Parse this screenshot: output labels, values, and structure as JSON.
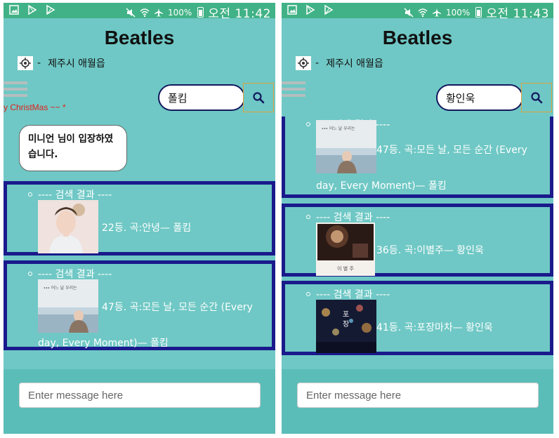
{
  "status_bar": [
    {
      "battery": "100%",
      "time": "오전 11:42"
    },
    {
      "battery": "100%",
      "time": "오전 11:43"
    }
  ],
  "header": {
    "title": "Beatles",
    "location_sep": "-",
    "location": "제주시 애월읍"
  },
  "ticker": "y ChristMas ~~ *",
  "search": [
    {
      "value": "폴킴"
    },
    {
      "value": "황인욱"
    }
  ],
  "system_message": "미니언 님이 입장하였습니다.",
  "result_heading": "---- 검색 결과 ----",
  "left_results": [
    {
      "text": "22등. 곡:안녕— 폴킴"
    },
    {
      "text_line1": "47등. 곡:모든 날, 모든 순간 (Every",
      "text_line2": "day, Every Moment)— 폴킴"
    }
  ],
  "right_results": [
    {
      "text_line1": "47등. 곡:모든 날, 모든 순간 (Every",
      "text_line2": "day, Every Moment)— 폴킴"
    },
    {
      "text": "36등. 곡:이별주— 황인욱"
    },
    {
      "text": "41등. 곡:포장마차— 황인욱"
    }
  ],
  "message_input": {
    "placeholder": "Enter message here"
  },
  "colors": {
    "app_bg": "#6fc8c5",
    "status_bar": "#41b287",
    "result_border": "#1a1a8c",
    "search_border": "#13195e",
    "ticker": "#e0211c"
  }
}
